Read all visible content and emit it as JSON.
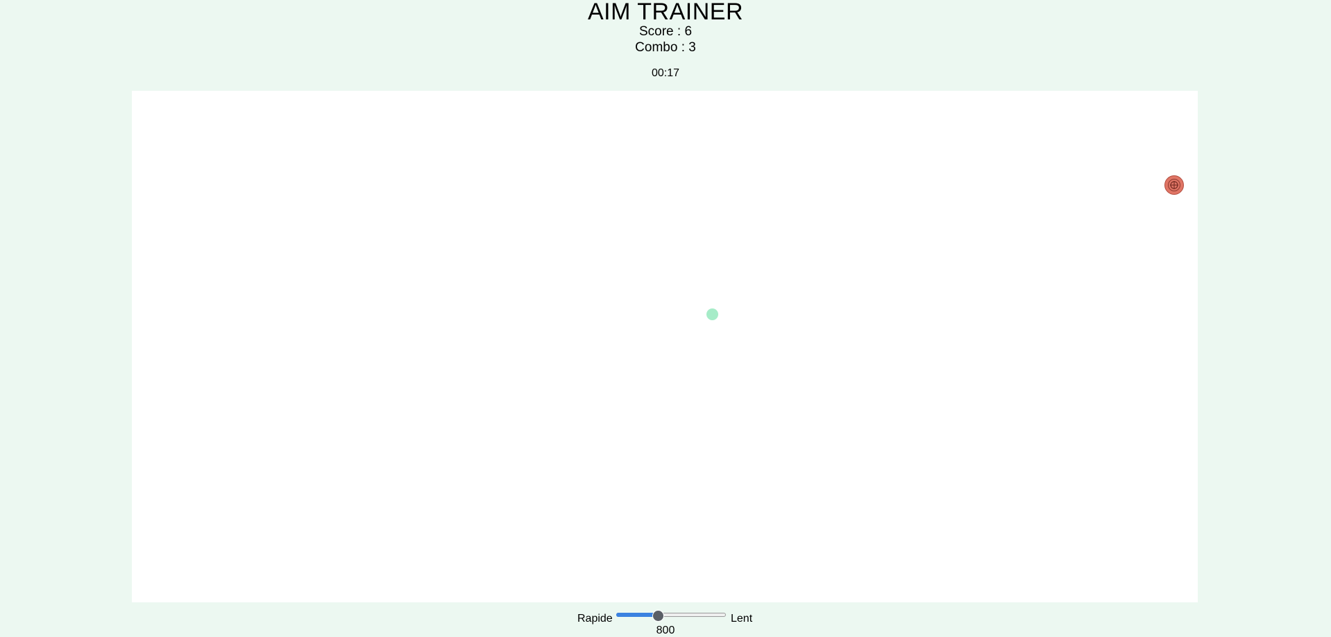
{
  "header": {
    "title": "AIM TRAINER",
    "score": "Score : 6",
    "combo": "Combo : 3",
    "timer": "00:17"
  },
  "game": {
    "target_icon": "crosshair-target-icon",
    "target_color": "#e07565",
    "ghost_dot_color": "#a6ecc8",
    "background": "#ffffff"
  },
  "controls": {
    "fast_label": "Rapide",
    "slow_label": "Lent",
    "speed_value": "800",
    "speed_level_fraction": 0.38,
    "accent_color": "#3b82e0"
  }
}
